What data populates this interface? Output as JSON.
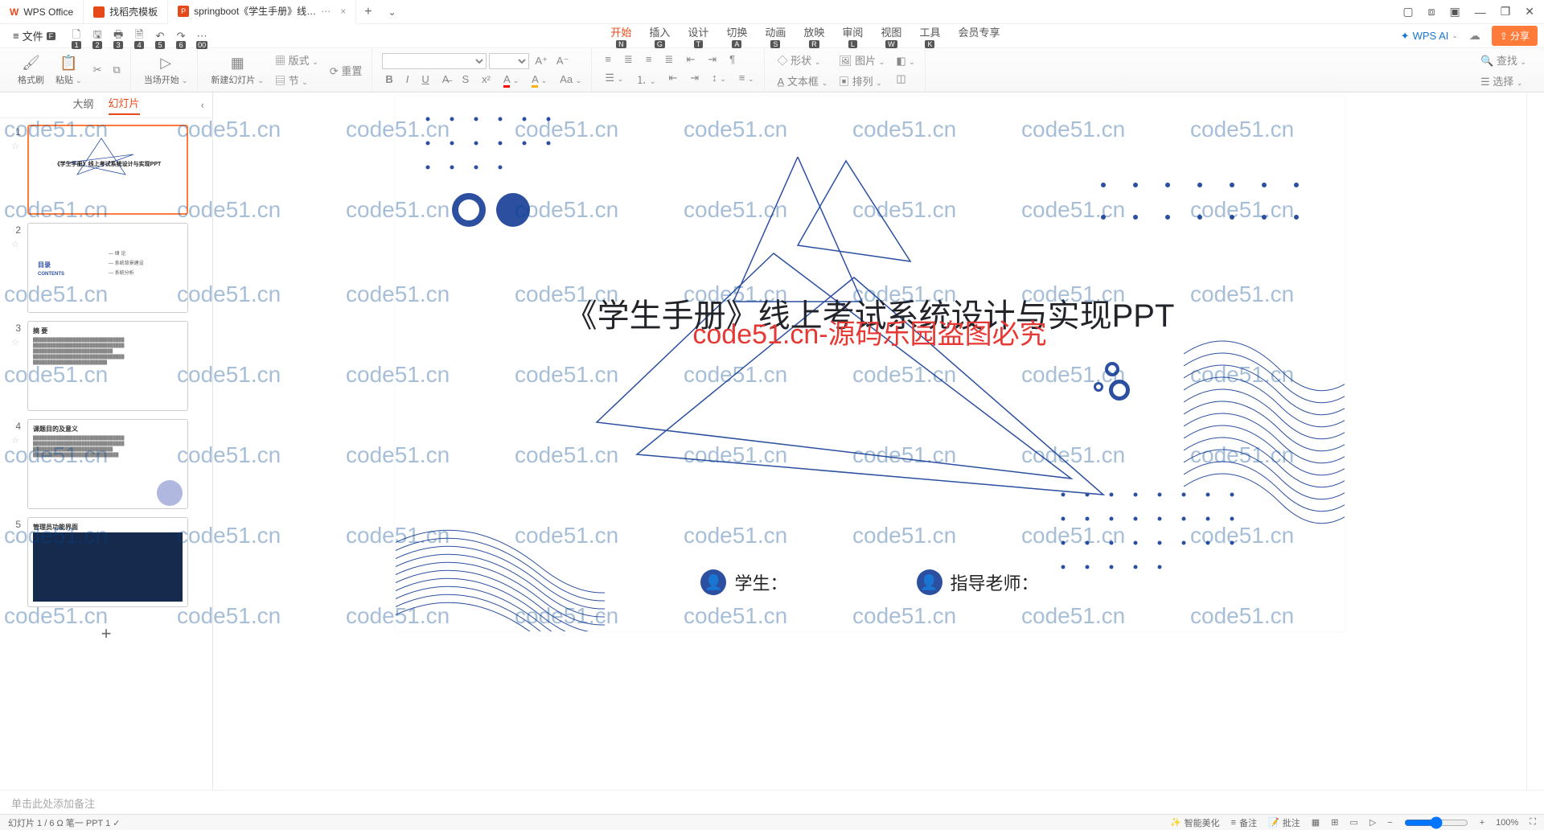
{
  "titlebar": {
    "tab1": "WPS Office",
    "tab2": "找稻壳模板",
    "tab3": "springboot《学生手册》线…",
    "add": "+"
  },
  "filemenu": {
    "label": "文件"
  },
  "qat": {
    "b1": "1",
    "b2": "2",
    "b3": "3",
    "b4": "4",
    "b5": "5",
    "b6": "6",
    "b7": "00"
  },
  "menu": {
    "start": "开始",
    "start_b": "N",
    "insert": "插入",
    "insert_b": "G",
    "design": "设计",
    "design_b": "T",
    "trans": "切换",
    "trans_b": "A",
    "anim": "动画",
    "anim_b": "S",
    "play": "放映",
    "play_b": "R",
    "review": "审阅",
    "review_b": "L",
    "view": "视图",
    "view_b": "W",
    "tools": "工具",
    "tools_b": "K",
    "member": "会员专享",
    "ai": "WPS AI",
    "share": "分享"
  },
  "ribbon": {
    "geshi": "格式刷",
    "paste": "粘贴",
    "curstart": "当场开始",
    "newslide": "新建幻灯片",
    "layout": "版式",
    "section": "节",
    "reset": "重置",
    "shape": "形状",
    "image": "图片",
    "textbox": "文本框",
    "arrange": "排列",
    "find": "查找",
    "select": "选择"
  },
  "panel": {
    "outline": "大纲",
    "slides": "幻灯片",
    "collapse": "‹"
  },
  "thumbs": {
    "t1_title": "《学生手册》线上考试系统设计与实现PPT",
    "t2_toc": "目录",
    "t2_contents": "CONTENTS",
    "t2_i1": "绪 论",
    "t2_i2": "系统背景建设",
    "t2_i3": "系统分析",
    "t3_h": "摘 要",
    "t4_h": "课题目的及意义",
    "t5_h": "管理员功能界面"
  },
  "slide": {
    "title": "《学生手册》线上考试系统设计与实现PPT",
    "red_wm": "code51.cn-源码乐园盗图必究",
    "student": "学生：",
    "teacher": "指导老师："
  },
  "notes": {
    "placeholder": "单击此处添加备注"
  },
  "status": {
    "left": "幻灯片 1 / 6    Ω 笔一 PPT    1 ✓",
    "ai_beautify": "智能美化",
    "notes": "备注",
    "comments": "批注",
    "zoom": "100%"
  },
  "watermark": "code51.cn"
}
